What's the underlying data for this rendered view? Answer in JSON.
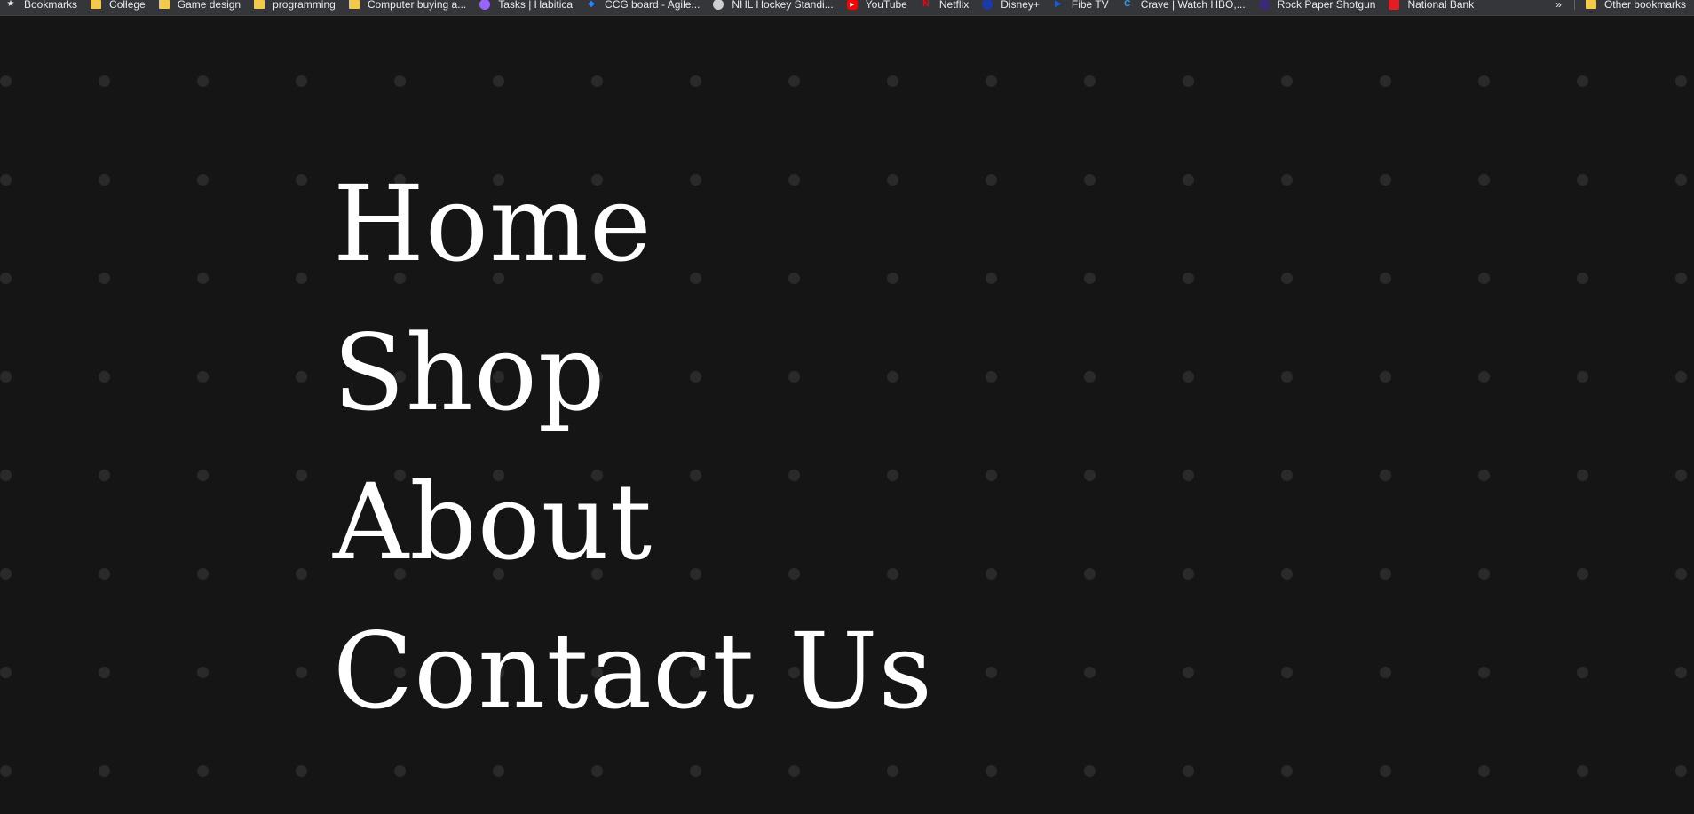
{
  "bookmarks_bar": {
    "items": [
      {
        "label": "Bookmarks",
        "icon": "star-icon"
      },
      {
        "label": "College",
        "icon": "folder-icon"
      },
      {
        "label": "Game design",
        "icon": "folder-icon"
      },
      {
        "label": "programming",
        "icon": "folder-icon"
      },
      {
        "label": "Computer buying a...",
        "icon": "folder-icon"
      },
      {
        "label": "Tasks | Habitica",
        "icon": "habitica-icon",
        "color": "#9a62ff"
      },
      {
        "label": "CCG board - Agile...",
        "icon": "jira-icon",
        "color": "#2684ff"
      },
      {
        "label": "NHL Hockey Standi...",
        "icon": "nhl-icon",
        "color": "#cfcfcf"
      },
      {
        "label": "YouTube",
        "icon": "youtube-icon",
        "color": "#ff0000"
      },
      {
        "label": "Netflix",
        "icon": "netflix-icon",
        "color": "#e50914"
      },
      {
        "label": "Disney+",
        "icon": "disney-icon",
        "color": "#1a3aa8"
      },
      {
        "label": "Fibe TV",
        "icon": "fibe-icon",
        "color": "#1f5bd6"
      },
      {
        "label": "Crave | Watch HBO,...",
        "icon": "crave-icon",
        "color": "#1ea7ff"
      },
      {
        "label": "Rock Paper Shotgun",
        "icon": "rps-icon",
        "color": "#3b2a7a"
      },
      {
        "label": "National Bank",
        "icon": "national-bank-icon",
        "color": "#e41c23"
      }
    ],
    "more_label": "»",
    "other_bookmarks": {
      "label": "Other bookmarks",
      "icon": "folder-icon"
    }
  },
  "nav": {
    "items": [
      {
        "label": "Home"
      },
      {
        "label": "Shop"
      },
      {
        "label": "About"
      },
      {
        "label": "Contact Us"
      }
    ]
  },
  "colors": {
    "background": "#151515",
    "dot": "#2a2a2a",
    "text": "#ffffff"
  }
}
